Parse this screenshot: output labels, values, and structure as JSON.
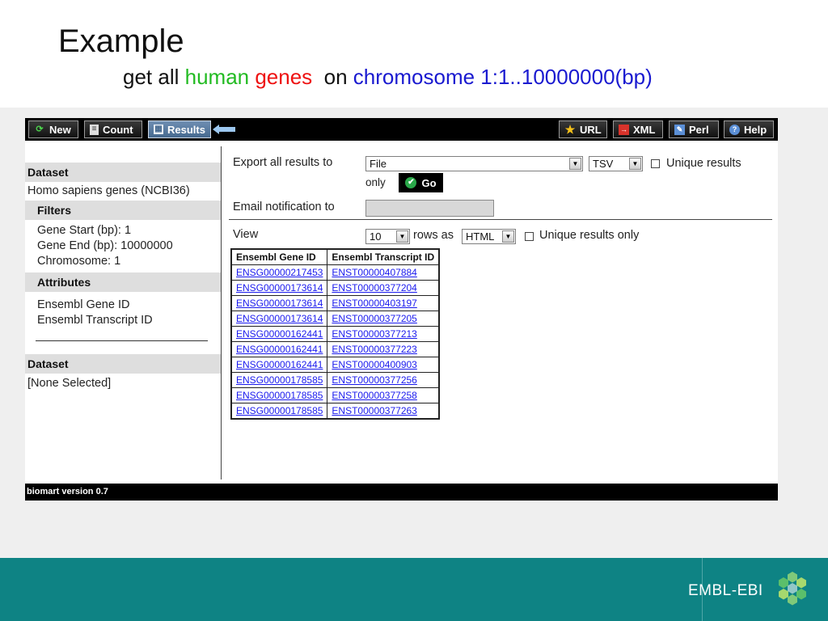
{
  "slide": {
    "title": "Example",
    "subtitle": {
      "part1": "get all ",
      "part2": "human",
      "part3": " genes",
      "part4": "  on ",
      "part5": "chromosome 1:1..10000000(bp)"
    },
    "brand": "EMBL-EBI"
  },
  "colors": {
    "human": "#22bb22",
    "genes": "#ee1111",
    "chromosome": "#1a1ad0",
    "bottom_band": "#0e8384"
  },
  "toolbar": {
    "new_label": "New",
    "count_label": "Count",
    "results_label": "Results",
    "url_label": "URL",
    "xml_label": "XML",
    "perl_label": "Perl",
    "help_label": "Help"
  },
  "left_panel": {
    "dataset1_header": "Dataset",
    "dataset1_name": "Homo sapiens genes (NCBI36)",
    "filters_header": "Filters",
    "filters": [
      "Gene Start (bp): 1",
      "Gene End (bp): 10000000",
      "Chromosome: 1"
    ],
    "attributes_header": "Attributes",
    "attributes": [
      "Ensembl Gene ID",
      "Ensembl Transcript ID"
    ],
    "dataset2_header": "Dataset",
    "dataset2_value": "[None Selected]"
  },
  "export": {
    "label": "Export  all results to",
    "file_value": "File",
    "format_value": "TSV",
    "unique_label": "Unique results",
    "unique_suffix": "only",
    "go_label": "Go"
  },
  "email": {
    "label": "Email notification to",
    "value": ""
  },
  "view": {
    "label": "View",
    "rows_value": "10",
    "rows_as_label": "rows as",
    "format_value": "HTML",
    "unique_label": "Unique results only"
  },
  "results_table": {
    "headers": [
      "Ensembl Gene ID",
      "Ensembl Transcript ID"
    ],
    "rows": [
      [
        "ENSG00000217453",
        "ENST00000407884"
      ],
      [
        "ENSG00000173614",
        "ENST00000377204"
      ],
      [
        "ENSG00000173614",
        "ENST00000403197"
      ],
      [
        "ENSG00000173614",
        "ENST00000377205"
      ],
      [
        "ENSG00000162441",
        "ENST00000377213"
      ],
      [
        "ENSG00000162441",
        "ENST00000377223"
      ],
      [
        "ENSG00000162441",
        "ENST00000400903"
      ],
      [
        "ENSG00000178585",
        "ENST00000377256"
      ],
      [
        "ENSG00000178585",
        "ENST00000377258"
      ],
      [
        "ENSG00000178585",
        "ENST00000377263"
      ]
    ]
  },
  "footer": {
    "version": "biomart version 0.7"
  }
}
